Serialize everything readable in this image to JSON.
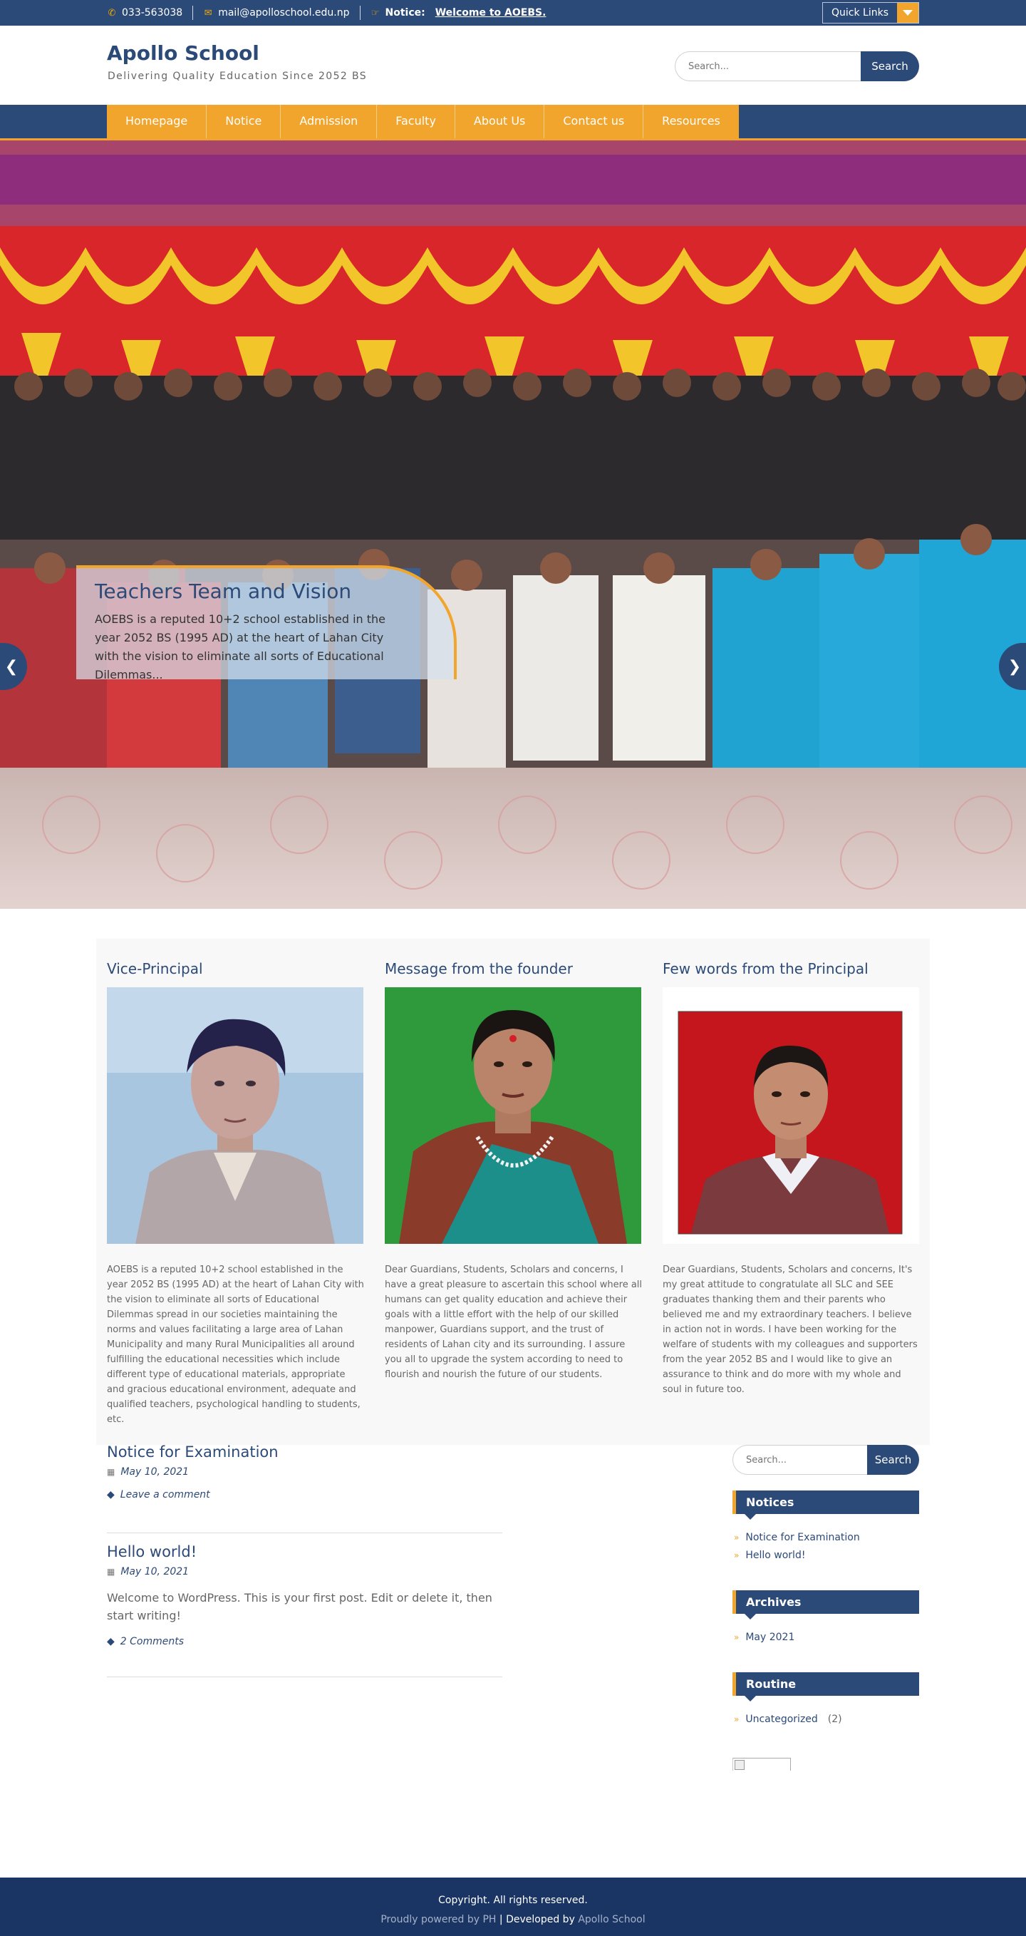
{
  "topbar": {
    "phone": "033-563038",
    "email": "mail@apolloschool.edu.np",
    "notice_label": "Notice:",
    "notice_text": "Welcome to AOEBS.",
    "quick_links": "Quick Links"
  },
  "header": {
    "site_title": "Apollo School",
    "tagline": "Delivering Quality Education Since 2052 BS",
    "search_placeholder": "Search...",
    "search_button": "Search"
  },
  "nav": {
    "items": [
      "Homepage",
      "Notice",
      "Admission",
      "Faculty",
      "About Us",
      "Contact us",
      "Resources"
    ]
  },
  "slider": {
    "title": "Teachers Team and Vision",
    "text": "AOEBS is a reputed 10+2 school established in the year 2052 BS (1995 AD) at the heart of Lahan City with the vision to eliminate all sorts of Educational Dilemmas..."
  },
  "features": [
    {
      "title": "Vice-Principal",
      "text": "AOEBS is a reputed 10+2 school established in the year 2052 BS (1995 AD) at the heart of Lahan City with the vision to eliminate all sorts of Educational Dilemmas spread in our societies maintaining the norms and values facilitating a large area of Lahan Municipality and many Rural Municipalities all around fulfilling the educational necessities which include different type of educational materials, appropriate and gracious educational environment, adequate and qualified teachers, psychological handling to students, etc."
    },
    {
      "title": "Message from the founder",
      "text": "Dear Guardians, Students, Scholars and concerns, I have a great pleasure to ascertain this school where all humans can get quality education and achieve their goals with a little effort with the help of our skilled manpower, Guardians support, and the trust of residents of Lahan city and its surrounding. I assure you all to upgrade the system according to need to flourish and nourish the future of our students."
    },
    {
      "title": "Few words from the Principal",
      "text": "Dear Guardians, Students, Scholars and concerns, It's my great attitude to congratulate all SLC and SEE graduates thanking them and their parents who believed me and my extraordinary teachers. I believe in action not in words. I have been working for the welfare of students with my colleagues and supporters from the year 2052 BS and I would like to give an assurance to think and do more with my whole and soul in future too."
    }
  ],
  "posts": [
    {
      "title": "Notice for Examination",
      "date": "May 10, 2021",
      "excerpt": "",
      "comments": "Leave a comment"
    },
    {
      "title": "Hello world!",
      "date": "May 10, 2021",
      "excerpt": "Welcome to WordPress. This is your first post. Edit or delete it, then start writing!",
      "comments": "2 Comments"
    }
  ],
  "sidebar": {
    "search_placeholder": "Search...",
    "search_button": "Search",
    "notices_title": "Notices",
    "notices": [
      "Notice for Examination",
      "Hello world!"
    ],
    "archives_title": "Archives",
    "archives": [
      "May 2021"
    ],
    "routine_title": "Routine",
    "routine_item": "Uncategorized",
    "routine_count": "(2)"
  },
  "footer": {
    "copyright": "Copyright. All rights reserved.",
    "powered_prefix": "Proudly powered by PH",
    "separator": " | ",
    "developed_prefix": "Developed by ",
    "developer": "Apollo School"
  },
  "colors": {
    "primary": "#2c4a78",
    "accent": "#f2a52c",
    "footer": "#1a3563"
  }
}
